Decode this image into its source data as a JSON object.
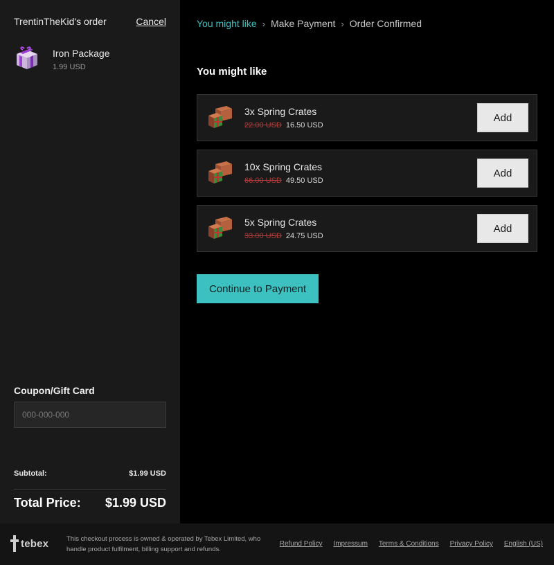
{
  "sidebar": {
    "order_title": "TrentinTheKid's order",
    "cancel_label": "Cancel",
    "cart_items": [
      {
        "name": "Iron Package",
        "price": "1.99 USD",
        "icon": "gift-box-icon"
      }
    ],
    "coupon": {
      "label": "Coupon/Gift Card",
      "placeholder": "000-000-000",
      "value": ""
    },
    "subtotal_label": "Subtotal:",
    "subtotal_value": "$1.99 USD",
    "total_label": "Total Price:",
    "total_value": "$1.99 USD"
  },
  "breadcrumb": [
    {
      "label": "You might like",
      "active": true
    },
    {
      "label": "Make Payment",
      "active": false
    },
    {
      "label": "Order Confirmed",
      "active": false
    }
  ],
  "main": {
    "section_title": "You might like",
    "upsells": [
      {
        "name": "3x Spring Crates",
        "old_price": "22.00 USD",
        "new_price": "16.50 USD",
        "button": "Add",
        "icon": "crate-icon"
      },
      {
        "name": "10x Spring Crates",
        "old_price": "66.00 USD",
        "new_price": "49.50 USD",
        "button": "Add",
        "icon": "crate-icon"
      },
      {
        "name": "5x Spring Crates",
        "old_price": "33.00 USD",
        "new_price": "24.75 USD",
        "button": "Add",
        "icon": "crate-icon"
      }
    ],
    "continue_label": "Continue to Payment"
  },
  "footer": {
    "brand": "tebex",
    "text": "This checkout process is owned & operated by Tebex Limited, who handle product fulfilment, billing support and refunds.",
    "links": [
      "Refund Policy",
      "Impressum",
      "Terms & Conditions",
      "Privacy Policy",
      "English (US)"
    ]
  },
  "colors": {
    "accent": "#3cc0c0",
    "sidebar_bg": "#1a1a1a",
    "main_bg": "#000000",
    "strike_price": "#b83a3a"
  }
}
